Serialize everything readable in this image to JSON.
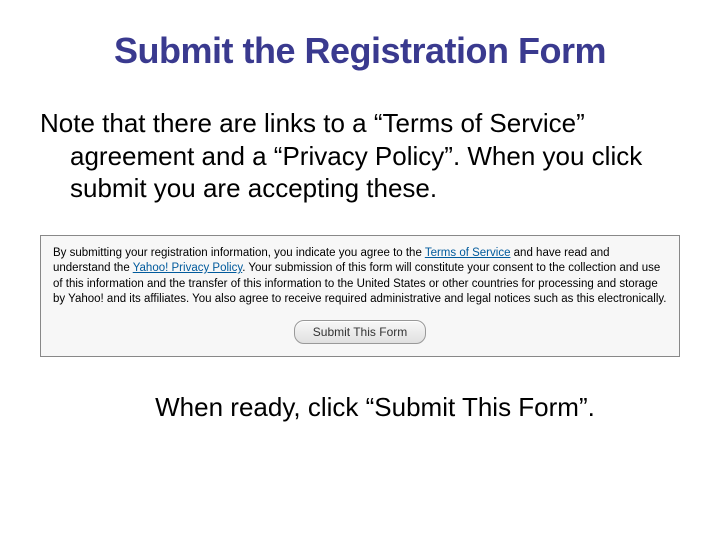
{
  "title": "Submit the Registration Form",
  "intro": "Note that there are links to a “Terms of Service” agreement and a “Privacy Policy”. When you click submit you are accepting these.",
  "disclosure": {
    "part1": "By submitting your registration information, you indicate you agree to the ",
    "link1": "Terms of Service",
    "part2": " and have read and understand the ",
    "link2": "Yahoo! Privacy Policy",
    "part3": ". Your submission of this form will constitute your consent to the collection and use of this information and the transfer of this information to the United States or other countries for processing and storage by Yahoo! and its affiliates. You also agree to receive required administrative and legal notices such as this electronically."
  },
  "submit_button": "Submit This Form",
  "footer": "When ready, click “Submit This Form”."
}
